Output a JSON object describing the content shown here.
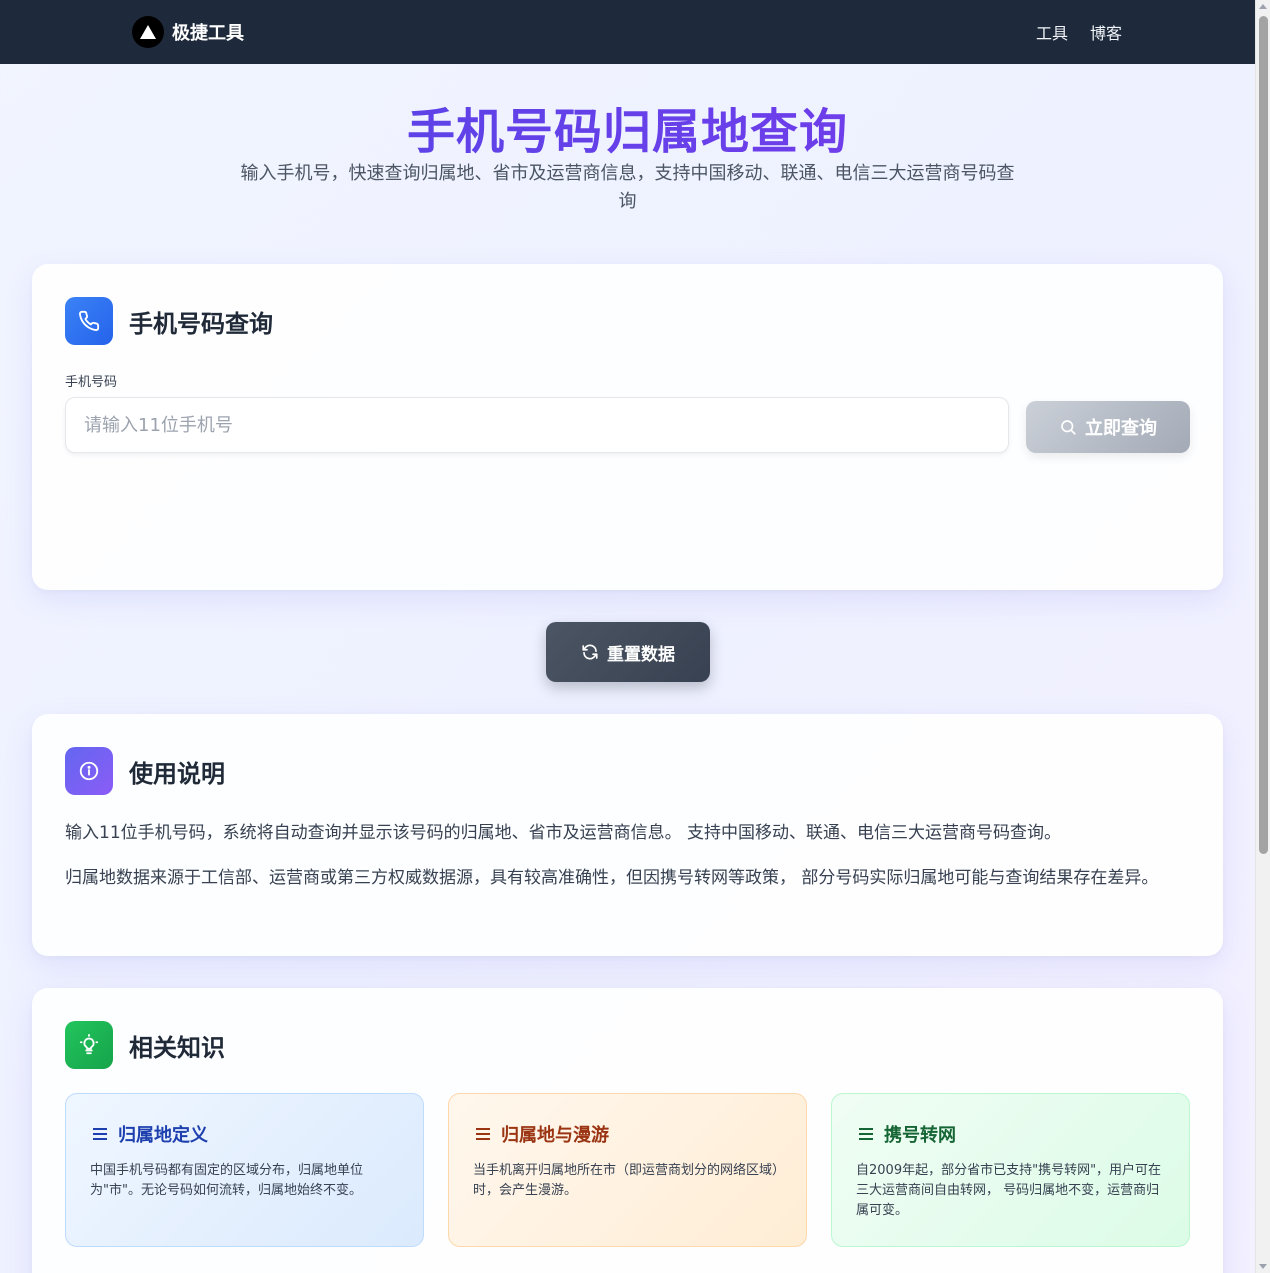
{
  "navbar": {
    "brand": "极捷工具",
    "links": [
      "工具",
      "博客"
    ]
  },
  "hero": {
    "title": "手机号码归属地查询",
    "subtitle": "输入手机号，快速查询归属地、省市及运营商信息，支持中国移动、联通、电信三大运营商号码查询"
  },
  "query_card": {
    "title": "手机号码查询",
    "field_label": "手机号码",
    "input_value": "",
    "input_placeholder": "请输入11位手机号",
    "button_label": "立即查询"
  },
  "reset_button": "重置数据",
  "usage": {
    "title": "使用说明",
    "paragraphs": [
      "输入11位手机号码，系统将自动查询并显示该号码的归属地、省市及运营商信息。 支持中国移动、联通、电信三大运营商号码查询。",
      "归属地数据来源于工信部、运营商或第三方权威数据源，具有较高准确性，但因携号转网等政策， 部分号码实际归属地可能与查询结果存在差异。"
    ]
  },
  "knowledge": {
    "title": "相关知识",
    "cards": [
      {
        "title": "归属地定义",
        "text": "中国手机号码都有固定的区域分布，归属地单位为\"市\"。无论号码如何流转，归属地始终不变。",
        "color": "#1e40af"
      },
      {
        "title": "归属地与漫游",
        "text": "当手机离开归属地所在市（即运营商划分的网络区域）时，会产生漫游。",
        "color": "#9a3412"
      },
      {
        "title": "携号转网",
        "text": "自2009年起，部分省市已支持\"携号转网\"，用户可在三大运营商间自由转网， 号码归属地不变，运营商归属可变。",
        "color": "#166534"
      }
    ]
  },
  "colors": {
    "navbar": "#1e293b",
    "title_gradient_start": "#4f46e5",
    "title_gradient_end": "#7c3aed"
  }
}
